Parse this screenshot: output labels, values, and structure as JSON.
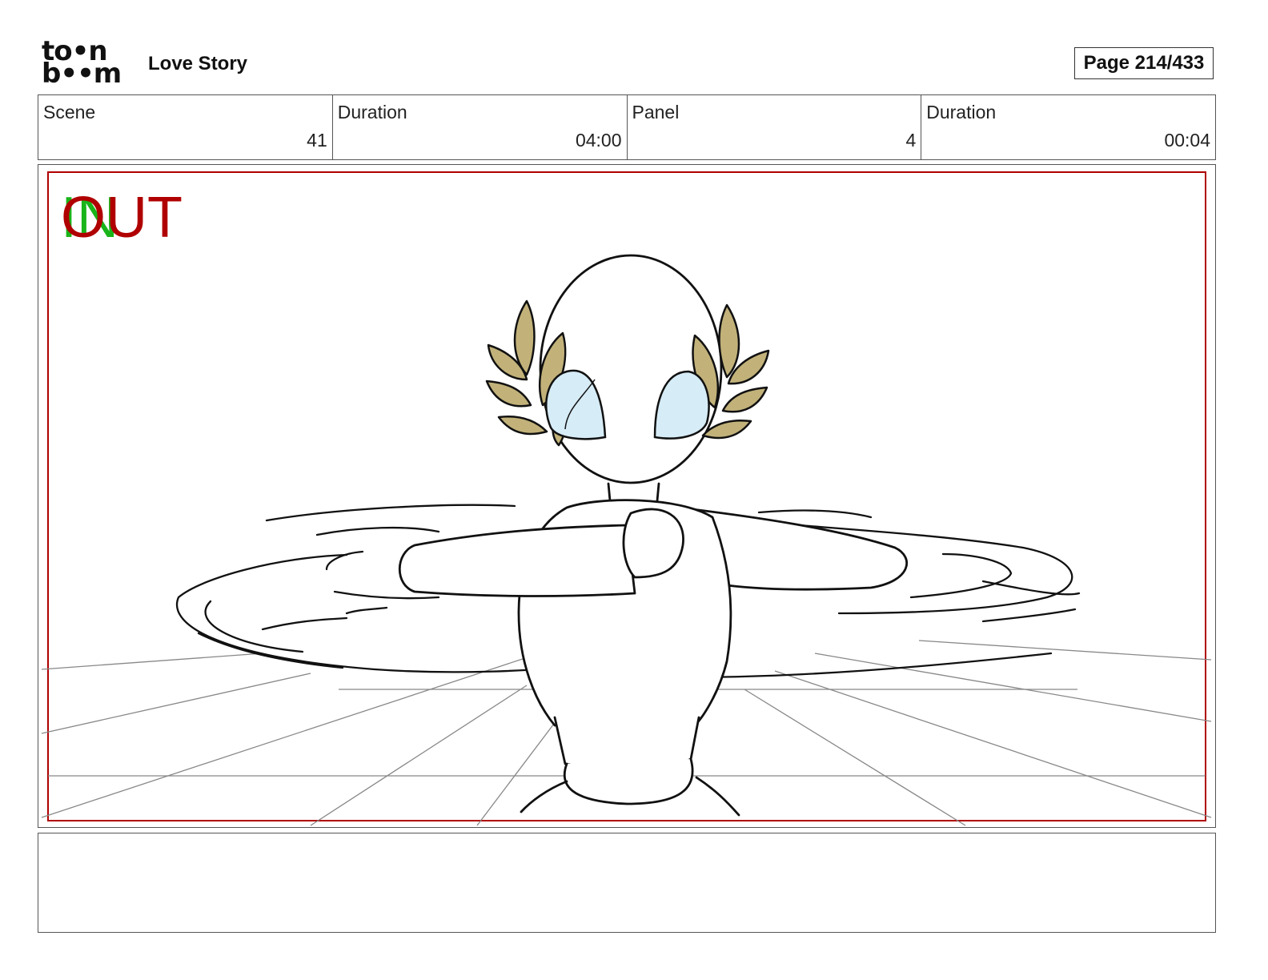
{
  "header": {
    "logo_line1": "to•n",
    "logo_line2": "b••m",
    "title": "Love Story",
    "page": "Page 214/433"
  },
  "info": {
    "scene_label": "Scene",
    "scene_value": "41",
    "duration1_label": "Duration",
    "duration1_value": "04:00",
    "panel_label": "Panel",
    "panel_value": "4",
    "duration2_label": "Duration",
    "duration2_value": "00:04"
  },
  "panel": {
    "in_label": "IN",
    "out_label": "OUT",
    "colors": {
      "safe_frame": "#b00000",
      "laurel": "#c2b27a",
      "eye": "#d6ecf7",
      "grid": "#888888",
      "in": "#19b419",
      "out": "#b00000"
    }
  },
  "notes": {
    "text": ""
  }
}
